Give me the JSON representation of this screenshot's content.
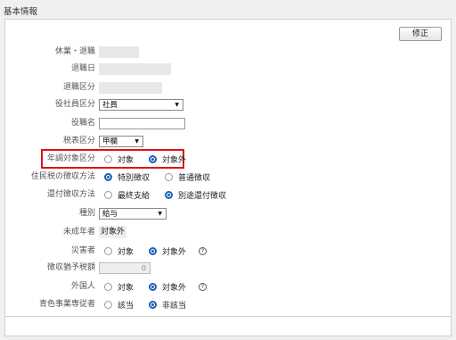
{
  "section": {
    "title": "基本情報"
  },
  "edit_button": "修正",
  "fields": {
    "leave": {
      "label": "休業・退職"
    },
    "retire_date": {
      "label": "退職日"
    },
    "retire_type": {
      "label": "退職区分"
    },
    "officer_type": {
      "label": "役社員区分",
      "value": "社員"
    },
    "title": {
      "label": "役職名",
      "value": ""
    },
    "tax_type": {
      "label": "税表区分",
      "value": "甲欄"
    },
    "year_end": {
      "label": "年調対象区分",
      "opt1": "対象",
      "opt2": "対象外",
      "selected": "対象外"
    },
    "resident_tax": {
      "label": "住民税の徴収方法",
      "opt1": "特別徴収",
      "opt2": "普通徴収",
      "selected": "特別徴収"
    },
    "refund": {
      "label": "還付徴収方法",
      "opt1": "最終支給",
      "opt2": "別途還付徴収",
      "selected": "別途還付徴収"
    },
    "kind": {
      "label": "種別",
      "value": "給与"
    },
    "minor": {
      "label": "未成年者",
      "value": "対象外"
    },
    "disaster": {
      "label": "災害者",
      "opt1": "対象",
      "opt2": "対象外",
      "selected": "対象外",
      "help": "?"
    },
    "withheld": {
      "label": "徴収猶予税額",
      "value": "0"
    },
    "foreigner": {
      "label": "外国人",
      "opt1": "対象",
      "opt2": "対象外",
      "selected": "対象外",
      "help": "?"
    },
    "blue_form": {
      "label": "青色事業専従者",
      "opt1": "該当",
      "opt2": "非該当",
      "selected": "非該当"
    }
  }
}
